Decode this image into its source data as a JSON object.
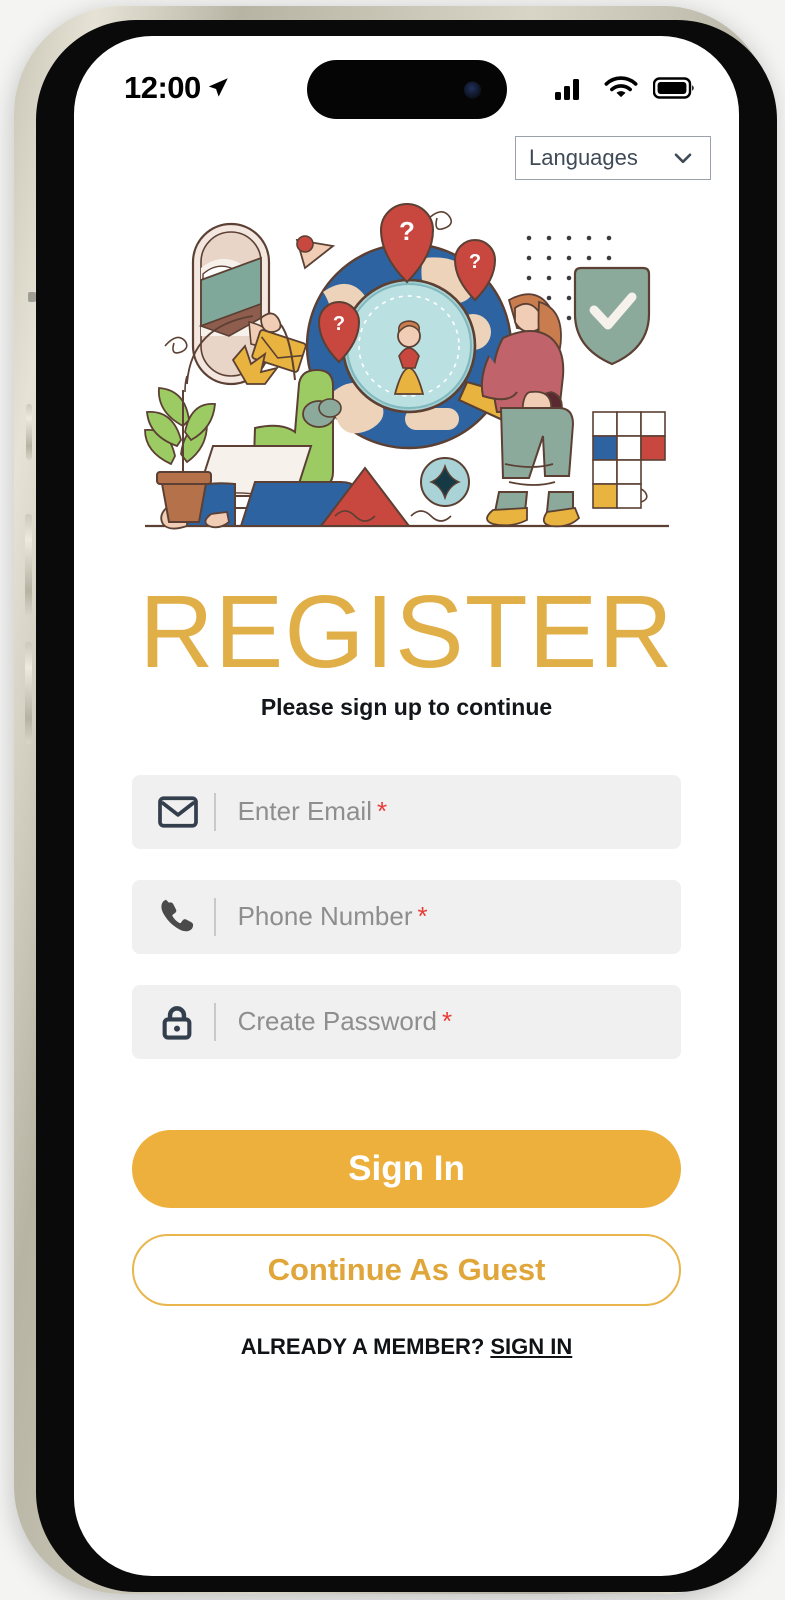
{
  "status_bar": {
    "time": "12:00",
    "location_icon": "location-arrow-icon",
    "signal_icon": "cellular-signal-icon",
    "wifi_icon": "wifi-icon",
    "battery_icon": "battery-full-icon"
  },
  "language_selector": {
    "label": "Languages",
    "chevron_icon": "chevron-down-icon"
  },
  "illustration": {
    "alt": "People searching a globe with location pins, magnifier, laptop, plant and security shield"
  },
  "header": {
    "title": "REGISTER",
    "subtitle": "Please sign up to continue"
  },
  "form": {
    "fields": [
      {
        "name": "email",
        "icon": "envelope-icon",
        "placeholder": "Enter Email",
        "required_mark": "*",
        "value": ""
      },
      {
        "name": "phone",
        "icon": "phone-icon",
        "placeholder": "Phone Number",
        "required_mark": "*",
        "value": ""
      },
      {
        "name": "password",
        "icon": "lock-icon",
        "placeholder": "Create Password",
        "required_mark": "*",
        "value": ""
      }
    ]
  },
  "actions": {
    "primary_label": "Sign In",
    "secondary_label": "Continue As Guest"
  },
  "footer": {
    "prompt": "ALREADY A MEMBER?",
    "link": "SIGN IN"
  },
  "colors": {
    "brand_amber": "#EDB03C",
    "title_amber": "#E1AF47",
    "required_red": "#E83B36",
    "field_bg": "#F0F0F0",
    "placeholder": "#8E8E8E",
    "select_border": "#9AA2AB"
  }
}
